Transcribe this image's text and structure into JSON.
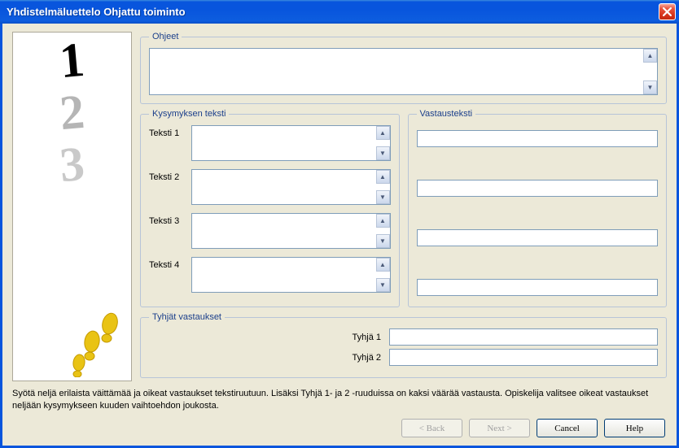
{
  "window": {
    "title": "Yhdistelmäluettelo Ohjattu toiminto"
  },
  "fieldsets": {
    "ohjeet": "Ohjeet",
    "kysymyksen": "Kysymyksen teksti",
    "vastaus": "Vastausteksti",
    "tyhjat": "Tyhjät vastaukset"
  },
  "labels": {
    "teksti1": "Teksti 1",
    "teksti2": "Teksti 2",
    "teksti3": "Teksti 3",
    "teksti4": "Teksti 4",
    "tyhja1": "Tyhjä 1",
    "tyhja2": "Tyhjä 2"
  },
  "values": {
    "ohjeet": "",
    "teksti1": "",
    "teksti2": "",
    "teksti3": "",
    "teksti4": "",
    "vastaus1": "",
    "vastaus2": "",
    "vastaus3": "",
    "vastaus4": "",
    "tyhja1": "",
    "tyhja2": ""
  },
  "footer": "Syötä neljä erilaista väittämää ja oikeat vastaukset tekstiruutuun. Lisäksi Tyhjä 1- ja 2 -ruuduissa on kaksi väärää vastausta. Opiskelija valitsee oikeat vastaukset neljään kysymykseen kuuden vaihtoehdon joukosta.",
  "buttons": {
    "back": "< Back",
    "next": "Next >",
    "cancel": "Cancel",
    "help": "Help"
  }
}
